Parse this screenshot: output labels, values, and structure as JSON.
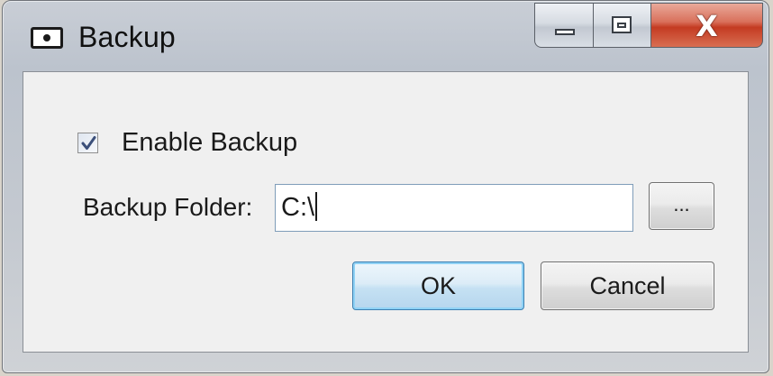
{
  "window": {
    "title": "Backup",
    "icon": "window-app-icon",
    "caption_buttons": {
      "minimize": "minimize-icon",
      "maximize": "maximize-icon",
      "close": "close-icon",
      "close_glyph": "X"
    },
    "colors": {
      "close_button": "#c43b22",
      "client_background": "#f0f0f0",
      "default_button_border": "#3c7fb1"
    }
  },
  "form": {
    "enable_backup": {
      "label": "Enable Backup",
      "checked": true
    },
    "backup_folder": {
      "label": "Backup Folder:",
      "value": "C:\\"
    },
    "browse_label": "...",
    "ok_label": "OK",
    "cancel_label": "Cancel"
  }
}
